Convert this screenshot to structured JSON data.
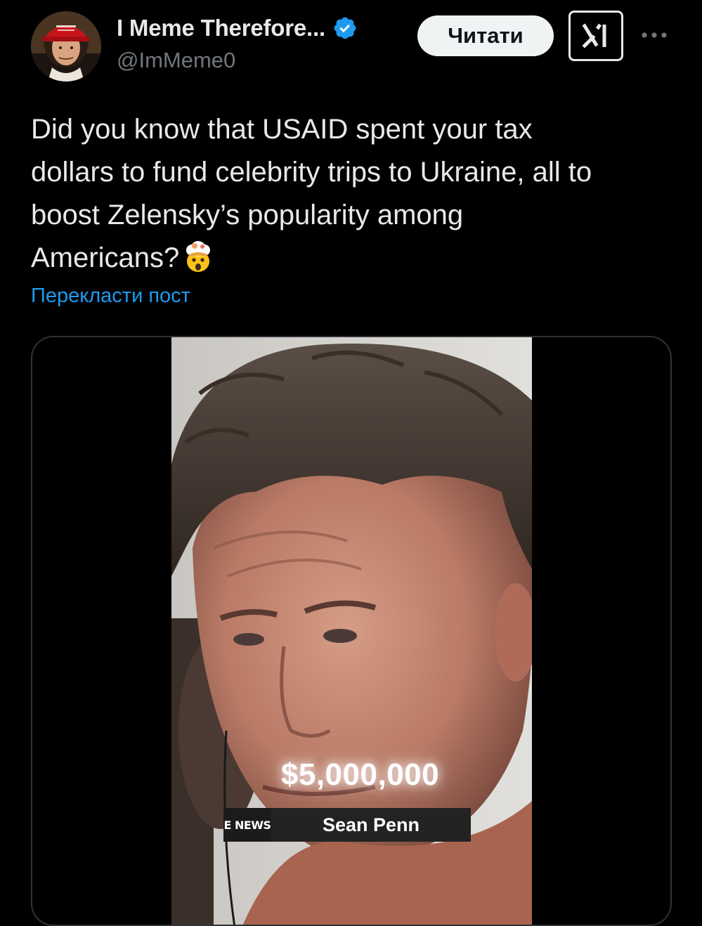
{
  "author": {
    "display_name": "I Meme Therefore...",
    "handle": "@ImMeme0",
    "verified": true,
    "avatar_icon": "portrait-avatar-red-cap"
  },
  "actions": {
    "follow_label": "Читати",
    "grok_icon": "grok-icon",
    "more_icon": "more-horizontal-icon"
  },
  "post": {
    "text_lines": [
      "Did you know that USAID spent your tax",
      "dollars to fund celebrity trips to Ukraine, all to",
      "boost Zelensky’s popularity among",
      "Americans?"
    ],
    "emoji": "exploding-head-emoji",
    "translate_label": "Перекласти пост"
  },
  "media": {
    "type": "video",
    "overlay_amount": "$5,000,000",
    "channel_logo": "E NEWS",
    "lower_third_name": "Sean Penn"
  },
  "colors": {
    "background": "#000000",
    "text": "#e7e9ea",
    "muted": "#71767b",
    "link": "#1d9bf0",
    "verified": "#1d9bf0",
    "border": "#2f3336"
  }
}
